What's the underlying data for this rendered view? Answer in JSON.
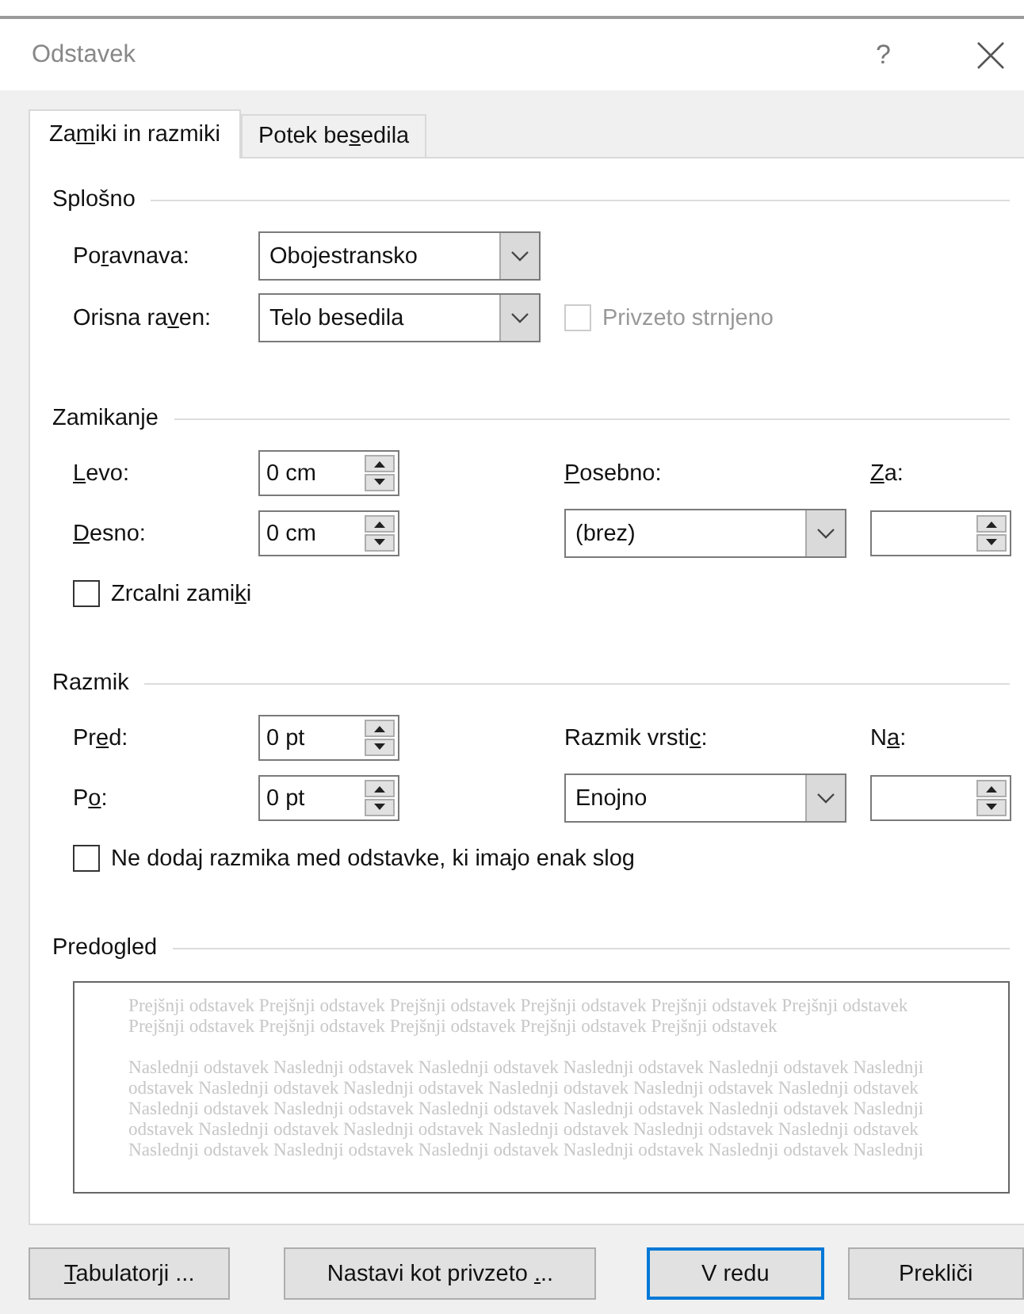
{
  "window": {
    "title": "Odstavek",
    "help": "?"
  },
  "tabs": [
    {
      "label": {
        "pre": "Za",
        "key": "m",
        "post": "iki in razmiki"
      },
      "selected": true
    },
    {
      "label": {
        "pre": "Potek be",
        "key": "s",
        "post": "edila"
      },
      "selected": false
    }
  ],
  "sections": [
    {
      "title": "Splošno",
      "rows": [
        [
          {
            "kind": "label",
            "text": {
              "pre": "Po",
              "key": "r",
              "post": "avnava:"
            }
          },
          {
            "kind": "combo",
            "value": "Obojestransko"
          }
        ],
        [
          {
            "kind": "label",
            "text": {
              "pre": "Orisna ra",
              "key": "v",
              "post": "en:"
            }
          },
          {
            "kind": "combo",
            "value": "Telo besedila"
          },
          {
            "kind": "checkbox",
            "text": {
              "pre": "Privzeto strnjeno"
            },
            "checked": false,
            "disabled": true
          }
        ]
      ]
    },
    {
      "title": "Zamikanje",
      "rows": [
        [
          {
            "kind": "label",
            "text": {
              "key": "L",
              "post": "evo:"
            }
          },
          {
            "kind": "spin",
            "value": "0 cm"
          },
          {
            "kind": "label",
            "text": {
              "key": "P",
              "post": "osebno:"
            }
          },
          {
            "kind": "label",
            "text": {
              "key": "Z",
              "post": "a:"
            }
          }
        ],
        [
          {
            "kind": "label",
            "text": {
              "key": "D",
              "post": "esno:"
            }
          },
          {
            "kind": "spin",
            "value": "0 cm"
          },
          {
            "kind": "combo",
            "value": "(brez)"
          },
          {
            "kind": "spin"
          }
        ],
        [
          {
            "kind": "checkbox",
            "text": {
              "pre": "Zrcalni zami",
              "key": "k",
              "post": "i"
            },
            "checked": false,
            "disabled": false
          }
        ]
      ]
    },
    {
      "title": "Razmik",
      "rows": [
        [
          {
            "kind": "label",
            "text": {
              "pre": "Pr",
              "key": "e",
              "post": "d:"
            }
          },
          {
            "kind": "spin",
            "value": "0 pt"
          },
          {
            "kind": "label",
            "text": {
              "pre": "Razmik vrsti",
              "key": "c",
              "post": ":"
            }
          },
          {
            "kind": "label",
            "text": {
              "pre": "N",
              "key": "a",
              "post": ":"
            }
          }
        ],
        [
          {
            "kind": "label",
            "text": {
              "pre": "P",
              "key": "o",
              "post": ":"
            }
          },
          {
            "kind": "spin",
            "value": "0 pt"
          },
          {
            "kind": "combo",
            "value": "Enojno"
          },
          {
            "kind": "spin"
          }
        ],
        [
          {
            "kind": "checkbox",
            "text": {
              "pre": "Ne doda",
              "key": "j",
              "post": " razmika med odstavke, ki imajo enak slog"
            },
            "checked": false,
            "disabled": false
          }
        ]
      ]
    }
  ],
  "preview": {
    "title": "Predogled",
    "previous": [
      "Prejšnji odstavek Prejšnji odstavek Prejšnji odstavek Prejšnji odstavek Prejšnji odstavek Prejšnji odstavek",
      "Prejšnji odstavek Prejšnji odstavek Prejšnji odstavek Prejšnji odstavek Prejšnji odstavek"
    ],
    "next": [
      "Naslednji odstavek Naslednji odstavek Naslednji odstavek Naslednji odstavek Naslednji odstavek Naslednji",
      "odstavek Naslednji odstavek Naslednji odstavek Naslednji odstavek Naslednji odstavek Naslednji odstavek",
      "Naslednji odstavek Naslednji odstavek Naslednji odstavek Naslednji odstavek Naslednji odstavek Naslednji",
      "odstavek Naslednji odstavek Naslednji odstavek Naslednji odstavek Naslednji odstavek Naslednji odstavek",
      "Naslednji odstavek Naslednji odstavek Naslednji odstavek Naslednji odstavek Naslednji odstavek Naslednji"
    ]
  },
  "buttons": [
    {
      "label": {
        "key": "T",
        "post": "abulatorji ..."
      },
      "default": false
    },
    {
      "label": {
        "pre": "Nastavi kot privzeto ",
        "key": ".",
        "post": ".."
      },
      "default": false
    },
    {
      "label": {
        "pre": "V redu"
      },
      "default": true
    },
    {
      "label": {
        "pre": "Prekliči"
      },
      "default": false
    }
  ]
}
